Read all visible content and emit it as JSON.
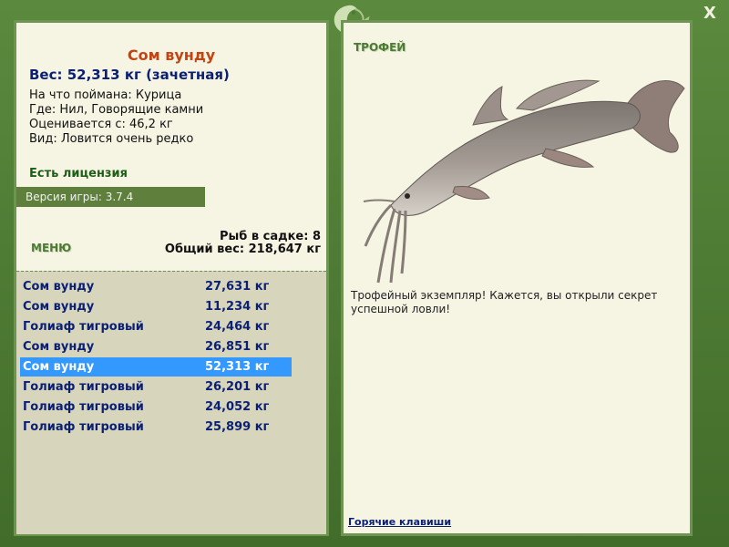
{
  "window": {
    "close_label": "X"
  },
  "fish": {
    "title": "Сом вунду",
    "weight_line": "Вес: 52,313 кг (зачетная)",
    "bait_line": "На что поймана: Курица",
    "place_line": "Где: Нил, Говорящие камни",
    "value_line": "Оценивается с: 46,2 кг",
    "rarity_line": "Вид: Ловится очень редко"
  },
  "license_text": "Есть лицензия",
  "version_text": "Версия игры: 3.7.4",
  "menu_label": "МЕНЮ",
  "cage": {
    "count_line": "Рыб в садке: 8",
    "total_line": "Общий вес: 218,647 кг"
  },
  "catch_list": [
    {
      "name": "Сом вунду",
      "weight": "27,631 кг"
    },
    {
      "name": "Сом вунду",
      "weight": "11,234 кг"
    },
    {
      "name": "Голиаф тигровый",
      "weight": "24,464 кг"
    },
    {
      "name": "Сом вунду",
      "weight": "26,851 кг"
    },
    {
      "name": "Сом вунду",
      "weight": "52,313 кг",
      "selected": true
    },
    {
      "name": "Голиаф тигровый",
      "weight": "26,201 кг"
    },
    {
      "name": "Голиаф тигровый",
      "weight": "24,052 кг"
    },
    {
      "name": "Голиаф тигровый",
      "weight": "25,899 кг"
    }
  ],
  "trophy": {
    "label": "ТРОФЕЙ",
    "description": "Трофейный экземпляр! Кажется, вы открыли секрет успешной ловли!"
  },
  "hotkeys_label": "Горячие клавиши",
  "colors": {
    "frame": "#4d7a34",
    "panel": "#f6f4e3",
    "title": "#c24413",
    "selected": "#3399ff",
    "text_blue": "#0b1f73"
  }
}
